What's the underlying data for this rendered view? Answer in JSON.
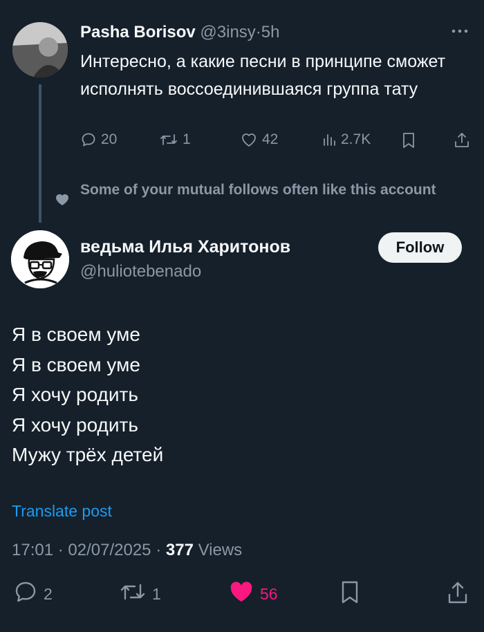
{
  "parent_tweet": {
    "name": "Pasha Borisov",
    "handle": "@3insy",
    "separator": "·",
    "time": "5h",
    "text": "Интересно, а какие песни в принципе сможет исполнять воссоединившаяся группа тату",
    "replies": "20",
    "retweets": "1",
    "likes": "42",
    "views": "2.7K"
  },
  "social_context": {
    "text": "Some of your mutual follows often like this account"
  },
  "main_tweet": {
    "name": "ведьма Илья Харитонов",
    "handle": "@huliotebenado",
    "follow_label": "Follow",
    "lines": [
      "Я в своем уме",
      "Я в своем уме",
      "Я хочу родить",
      "Я хочу родить",
      "Мужу трёх детей"
    ],
    "translate_label": "Translate post",
    "time": "17:01",
    "date": "02/07/2025",
    "views_count": "377",
    "views_label": "Views",
    "replies": "2",
    "retweets": "1",
    "likes": "56"
  },
  "colors": {
    "background": "#15202b",
    "text_primary": "#f7f9f9",
    "text_secondary": "#8b98a5",
    "link": "#1d9bf0",
    "like_active": "#f91880"
  }
}
